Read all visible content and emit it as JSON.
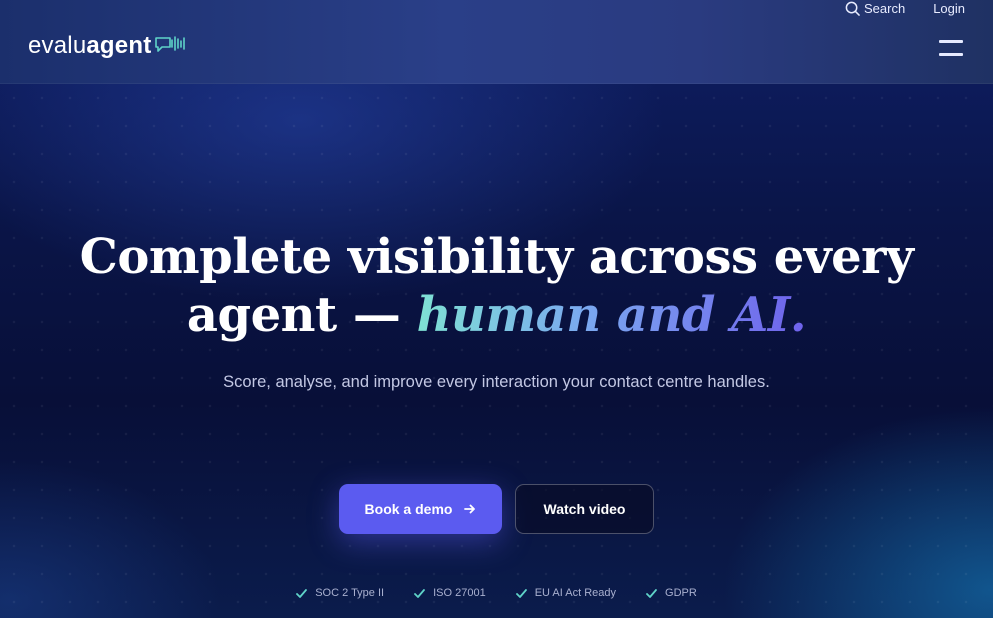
{
  "header": {
    "logo": {
      "part1": "evalu",
      "part2": "agent",
      "icon": "chat-wave-icon"
    },
    "search_label": "Search",
    "login_label": "Login",
    "menu_icon": "hamburger-menu-icon"
  },
  "hero": {
    "headline_line1": "Complete visibility across every",
    "headline_line2_plain": "agent — ",
    "headline_line2_accent": "human and AI.",
    "subtitle": "Score, analyse, and improve every interaction your contact centre handles.",
    "primary_button": "Book a demo",
    "secondary_button": "Watch video"
  },
  "badges": [
    "SOC 2 Type II",
    "ISO 27001",
    "EU AI Act Ready",
    "GDPR"
  ],
  "colors": {
    "accent": "#5b5bf0",
    "teal": "#5fd3c8",
    "background": "#0a1548"
  }
}
